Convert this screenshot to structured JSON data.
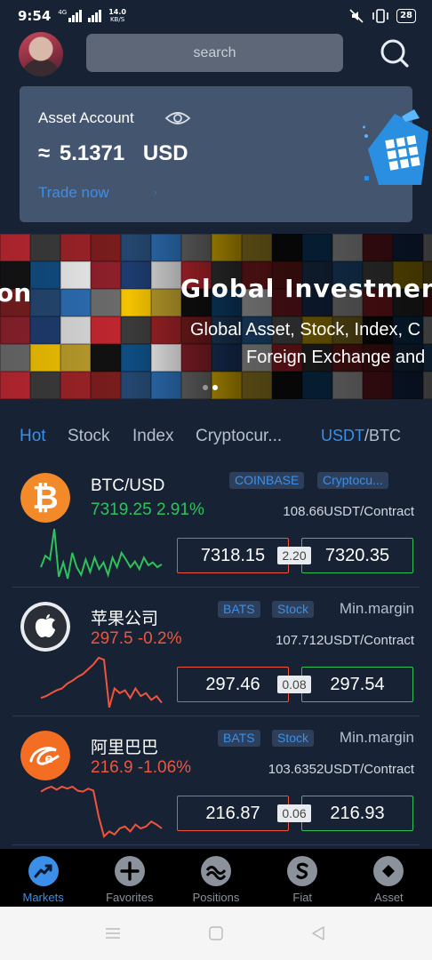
{
  "status_bar": {
    "time": "9:54",
    "network": "4G",
    "speed_value": "14.0",
    "speed_unit": "KB/S",
    "battery": "28"
  },
  "header": {
    "search_placeholder": "search"
  },
  "asset_card": {
    "title": "Asset Account",
    "amount": "≈ 5.1371",
    "currency": "USD",
    "trade_link": "Trade now",
    "trade_arrow": "›"
  },
  "banner": {
    "title": "Global Investment",
    "subtitle_1": "Global Asset, Stock, Index, C",
    "subtitle_2": "Foreign Exchange and",
    "left_fragment": "on",
    "slide_count": 2,
    "active_slide": 2
  },
  "tabs": {
    "items": [
      {
        "label": "Hot",
        "active": true
      },
      {
        "label": "Stock",
        "active": false
      },
      {
        "label": "Index",
        "active": false
      },
      {
        "label": "Cryptocur...",
        "active": false
      }
    ],
    "quote_on": "USDT",
    "quote_separator": "/",
    "quote_off": "BTC"
  },
  "markets": [
    {
      "name": "BTC/USD",
      "price_change": "7319.25 2.91%",
      "direction": "up",
      "tags": [
        "COINBASE",
        "Cryptocu..."
      ],
      "margin_label": "",
      "contract": "108.66USDT/Contract",
      "sell": "7318.15",
      "spread": "2.20",
      "buy": "7320.35",
      "logo": "bitcoin-logo",
      "trend": [
        30,
        42,
        38,
        70,
        20,
        35,
        18,
        45,
        30,
        22,
        38,
        25,
        40,
        28,
        35,
        22,
        40,
        30,
        45,
        38,
        30,
        36,
        28,
        40,
        32,
        35,
        30,
        33
      ],
      "trend_color": "#2fc25b"
    },
    {
      "name": "苹果公司",
      "price_change": "297.5 -0.2%",
      "direction": "down",
      "tags": [
        "BATS",
        "Stock"
      ],
      "margin_label": "Min.margin",
      "contract": "107.712USDT/Contract",
      "sell": "297.46",
      "spread": "0.08",
      "buy": "297.54",
      "logo": "apple-logo",
      "trend": [
        20,
        22,
        25,
        28,
        30,
        35,
        38,
        42,
        45,
        50,
        55,
        62,
        60,
        10,
        30,
        25,
        28,
        20,
        30,
        22,
        25,
        18,
        22,
        15
      ],
      "trend_color": "#f0553c"
    },
    {
      "name": "阿里巴巴",
      "price_change": "216.9 -1.06%",
      "direction": "down",
      "tags": [
        "BATS",
        "Stock"
      ],
      "margin_label": "Min.margin",
      "contract": "103.6352USDT/Contract",
      "sell": "216.87",
      "spread": "0.06",
      "buy": "216.93",
      "logo": "alibaba-logo",
      "trend": [
        55,
        58,
        60,
        57,
        60,
        58,
        60,
        56,
        55,
        58,
        56,
        30,
        10,
        15,
        12,
        18,
        20,
        15,
        22,
        18,
        20,
        25,
        22,
        18
      ],
      "trend_color": "#f0553c"
    }
  ],
  "bottom_nav": {
    "items": [
      {
        "label": "Markets",
        "active": true
      },
      {
        "label": "Favorites",
        "active": false
      },
      {
        "label": "Positions",
        "active": false
      },
      {
        "label": "Fiat",
        "active": false
      },
      {
        "label": "Asset",
        "active": false
      }
    ]
  },
  "colors": {
    "accent": "#3b8fe8",
    "up": "#2fc25b",
    "down": "#f0553c",
    "background": "#172235"
  },
  "icons": {
    "search": "search-icon",
    "eye": "eye-icon",
    "gift": "gift-icon",
    "nav": [
      "markets-chart-icon",
      "plus-icon",
      "positions-wave-icon",
      "fiat-s-icon",
      "asset-diamond-icon"
    ]
  }
}
